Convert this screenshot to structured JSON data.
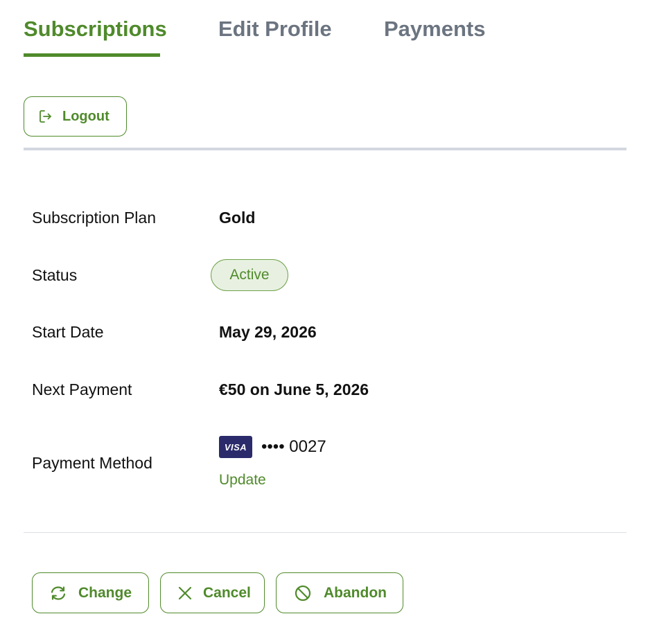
{
  "tabs": [
    {
      "label": "Subscriptions",
      "active": true
    },
    {
      "label": "Edit Profile",
      "active": false
    },
    {
      "label": "Payments",
      "active": false
    }
  ],
  "logout": {
    "label": "Logout",
    "icon": "logout-icon"
  },
  "details": {
    "plan": {
      "label": "Subscription Plan",
      "value": "Gold"
    },
    "status": {
      "label": "Status",
      "value": "Active"
    },
    "start_date": {
      "label": "Start Date",
      "value": "May 29, 2026"
    },
    "next_payment": {
      "label": "Next Payment",
      "value": "€50 on June 5, 2026"
    },
    "payment_method": {
      "label": "Payment Method",
      "card_brand": "VISA",
      "card_masked": "•••• 0027",
      "update_label": "Update"
    }
  },
  "actions": {
    "change": {
      "label": "Change",
      "icon": "refresh-icon"
    },
    "cancel": {
      "label": "Cancel",
      "icon": "close-icon"
    },
    "abandon": {
      "label": "Abandon",
      "icon": "block-icon"
    }
  },
  "colors": {
    "accent": "#4f8a2b",
    "inactive_tab": "#6b7480",
    "badge_bg": "#e8f1e1",
    "visa_bg": "#2b2a6b",
    "divider": "#d3d8e0"
  }
}
